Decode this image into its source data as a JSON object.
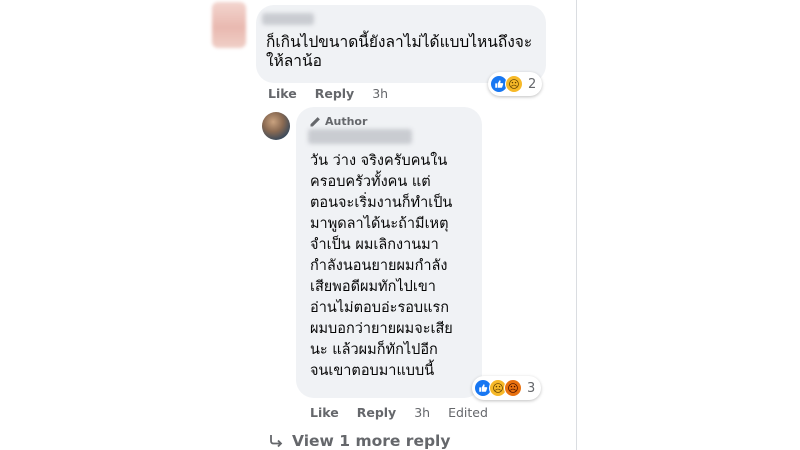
{
  "comments": [
    {
      "text": "ก็เกินไปขนาดนี้ยังลาไม่ได้แบบไหนถึงจะให้ลาน้อ",
      "reactions": {
        "icons": [
          "like",
          "sad"
        ],
        "count": "2"
      },
      "actions": {
        "like": "Like",
        "reply": "Reply",
        "time": "3h"
      }
    },
    {
      "badge": "Author",
      "text": "วัน ว่าง จริงครับคนในครอบครัวทั้งคน แต่ตอนจะเริ่มงานก็ทำเป็นมาพูดลาได้นะถ้ามีเหตุจำเป็น ผมเลิกงานมากำลังนอนยายผมกำลังเสียพอดีผมทักไปเขาอ่านไม่ตอบอ่ะรอบแรก ผมบอกว่ายายผมจะเสียนะ แล้วผมก็ทักไปอีกจนเขาตอบมาแบบนี้",
      "lines": [
        "วัน ว่าง จริงครับคนใน",
        "ครอบครัวทั้งคน แต่",
        "ตอนจะเริ่มงานก็ทำเป็น",
        "มาพูดลาได้นะถ้ามีเหตุ",
        "จำเป็น ผมเลิกงานมา",
        "กำลังนอนยายผมกำลัง",
        "เสียพอดีผมทักไปเขา",
        "อ่านไม่ตอบอ่ะรอบแรก",
        "ผมบอกว่ายายผมจะเสีย",
        "นะ แล้วผมก็ทักไปอีก",
        "จนเขาตอบมาแบบนี้"
      ],
      "reactions": {
        "icons": [
          "like",
          "sad",
          "angry"
        ],
        "count": "3"
      },
      "actions": {
        "like": "Like",
        "reply": "Reply",
        "time": "3h",
        "edited": "Edited"
      }
    }
  ],
  "view_more": "View 1 more reply",
  "colors": {
    "bubble": "#f0f2f5",
    "meta": "#65676b",
    "like": "#1877f2",
    "sad": "#f7b928",
    "angry": "#e9710f"
  }
}
